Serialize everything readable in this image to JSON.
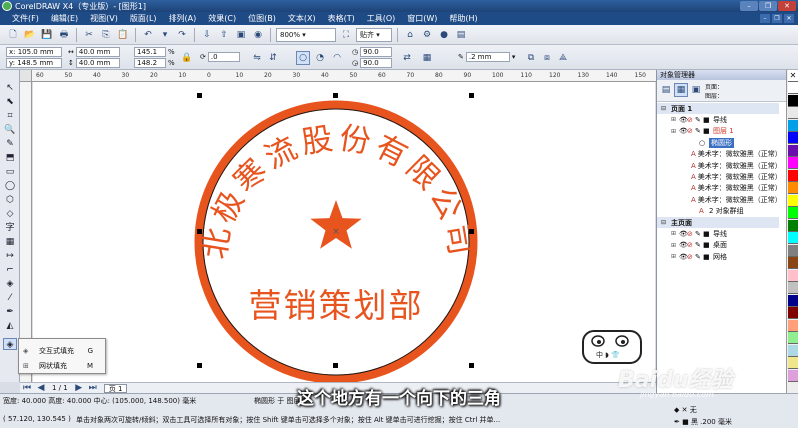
{
  "window": {
    "title": "CorelDRAW X4（专业版）- [图形1]",
    "min": "–",
    "max": "❐",
    "close": "✕"
  },
  "menu": [
    "文件(F)",
    "编辑(E)",
    "视图(V)",
    "版面(L)",
    "排列(A)",
    "效果(C)",
    "位图(B)",
    "文本(X)",
    "表格(T)",
    "工具(O)",
    "窗口(W)",
    "帮助(H)"
  ],
  "toolbar": {
    "snap_label": "贴齐",
    "zoom": "800%"
  },
  "props": {
    "x": "x: 105.0 mm",
    "y": "y: 148.5 mm",
    "w": "40.0 mm",
    "h": "40.0 mm",
    "sx": "145.1",
    "sy": "148.2",
    "pct": "%",
    "rot": ".0",
    "a1": "90.0",
    "a2": "90.0",
    "outline": ".2 mm"
  },
  "ruler_labels": [
    "60",
    "50",
    "40",
    "30",
    "20",
    "10",
    "0",
    "10",
    "20",
    "30",
    "40",
    "50",
    "60",
    "70",
    "80",
    "90",
    "100",
    "110",
    "120",
    "130",
    "140",
    "150"
  ],
  "canvas": {
    "seal_text": "北极寒流股份有限公司",
    "dept_text": "营销策划部",
    "seal_color": "#e8541e"
  },
  "flyout": [
    {
      "label": "交互式填充",
      "key": "G"
    },
    {
      "label": "网状填充",
      "key": "M"
    }
  ],
  "docker": {
    "title": "对象管理器",
    "page_label_1": "页面：",
    "page_label_2": "图层：",
    "rows": [
      {
        "text": "页面 1",
        "type": "section"
      },
      {
        "text": "导线",
        "type": "layer"
      },
      {
        "text": "图层 1",
        "type": "layer-red"
      },
      {
        "text": "椭圆形",
        "type": "sel"
      },
      {
        "text": "美术字：微软雅黑（正常）",
        "type": "obj"
      },
      {
        "text": "美术字：微软雅黑（正常）",
        "type": "obj"
      },
      {
        "text": "美术字：微软雅黑（正常）",
        "type": "obj"
      },
      {
        "text": "美术字：微软雅黑（正常）",
        "type": "obj"
      },
      {
        "text": "美术字：微软雅黑（正常）",
        "type": "obj"
      },
      {
        "text": "2 对象群组",
        "type": "obj"
      },
      {
        "text": "主页面",
        "type": "section"
      },
      {
        "text": "导线",
        "type": "layer"
      },
      {
        "text": "桌面",
        "type": "layer"
      },
      {
        "text": "网格",
        "type": "layer"
      }
    ]
  },
  "page_nav": {
    "pages": "1 / 1",
    "tab": "页 1"
  },
  "status": {
    "line1": "宽度: 40.000  高度: 40.000  中心: (105.000, 148.500)  毫米",
    "layer_info": "椭圆形 于 图层 1",
    "line2": "( 57.120, 130.545 )",
    "hint": "单击对象两次可旋转/倾斜；双击工具可选择所有对象；按住 Shift 键单击可选择多个对象；按住 Alt 键单击可进行挖掘；按住 Ctrl 并单...",
    "fill": "无",
    "outline": "黑 .200 毫米"
  },
  "overlay": {
    "subtitle": "这个地方有一个向下的三角",
    "watermark": "Baidu经验",
    "watermark_url": "jingyan.baidu.com"
  },
  "palette": [
    "#ffffff",
    "#000000",
    "#e8e8e8",
    "#00a0e9",
    "#0000ff",
    "#6a0dad",
    "#ff00ff",
    "#ff0000",
    "#ff8c00",
    "#ffff00",
    "#00ff00",
    "#008000",
    "#00ffff",
    "#808080",
    "#8b4513",
    "#ffc0cb",
    "#c0c0c0",
    "#00008b",
    "#800000",
    "#ffa07a",
    "#90ee90",
    "#add8e6",
    "#f0e68c",
    "#dda0dd"
  ]
}
